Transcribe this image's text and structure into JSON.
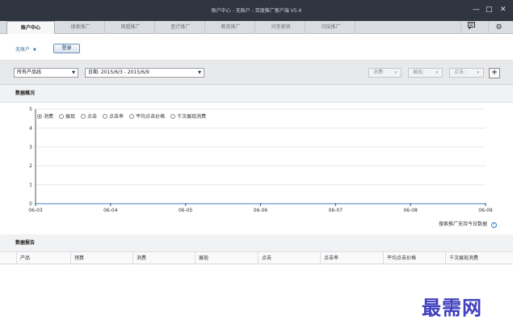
{
  "window": {
    "title": "账户中心 - 无账户 - 百度推广客户端 V5.4",
    "minimize_glyph": "—",
    "maximize_glyph": "□",
    "close_glyph": "✕"
  },
  "tabs": [
    {
      "label": "账户中心",
      "active": true
    },
    {
      "label": "搜索推广",
      "active": false
    },
    {
      "label": "网盟推广",
      "active": false
    },
    {
      "label": "医疗推广",
      "active": false
    },
    {
      "label": "教育推广",
      "active": false
    },
    {
      "label": "问答营销",
      "active": false
    },
    {
      "label": "闪投推广",
      "active": false
    }
  ],
  "toolbar": {
    "message_icon": "message-icon",
    "settings_icon": "gear-icon"
  },
  "account": {
    "selected": "无账户",
    "login_label": "登录"
  },
  "filters": {
    "product_line": "所有产品线",
    "date_range": "日期: 2015/6/3 - 2015/6/9",
    "metrics": [
      {
        "label": "消费:"
      },
      {
        "label": "展现:"
      },
      {
        "label": "点击:"
      }
    ],
    "add_label": "+"
  },
  "overview": {
    "title": "数据概况",
    "radio_options": [
      {
        "label": "消费",
        "checked": true
      },
      {
        "label": "展现",
        "checked": false
      },
      {
        "label": "点击",
        "checked": false
      },
      {
        "label": "点击率",
        "checked": false
      },
      {
        "label": "平均点击价格",
        "checked": false
      },
      {
        "label": "千次展现消费",
        "checked": false
      }
    ],
    "note": "搜索推广支持今日数据"
  },
  "chart_data": {
    "type": "line",
    "categories": [
      "06-03",
      "06-04",
      "06-05",
      "06-06",
      "06-07",
      "06-08",
      "06-09"
    ],
    "series": [
      {
        "values": [
          0,
          0,
          0,
          0,
          0,
          0,
          0
        ]
      }
    ],
    "yticks": [
      0,
      1,
      2,
      3,
      4,
      5
    ],
    "ylim": [
      0,
      5
    ],
    "grid": true,
    "line_color": "#4a7cc0"
  },
  "report": {
    "title": "数据报告",
    "columns": [
      "产品",
      "预算",
      "消费",
      "展现",
      "点击",
      "点击率",
      "平均点击价格",
      "千次展现消费"
    ]
  },
  "watermark": "最需网"
}
